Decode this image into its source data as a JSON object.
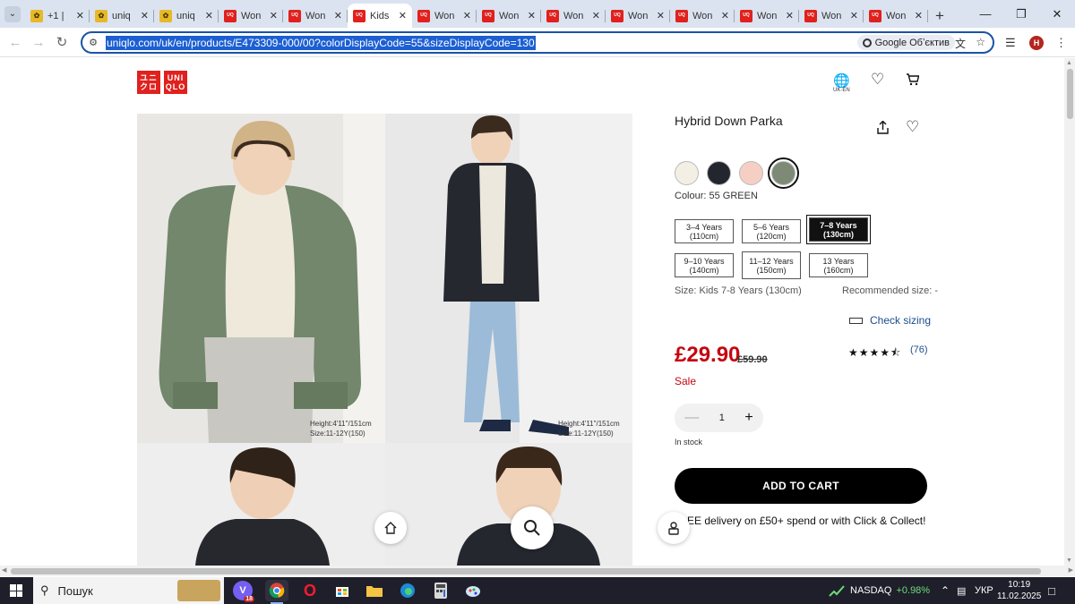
{
  "browser": {
    "tabs": [
      {
        "label": "+1 |",
        "icon": "yellow-icon",
        "active": false
      },
      {
        "label": "uniq",
        "icon": "yellow-icon",
        "active": false
      },
      {
        "label": "uniq",
        "icon": "yellow-icon",
        "active": false
      },
      {
        "label": "Won",
        "icon": "uniqlo-icon",
        "active": false
      },
      {
        "label": "Won",
        "icon": "uniqlo-icon",
        "active": false
      },
      {
        "label": "Kids",
        "icon": "uniqlo-icon",
        "active": true
      },
      {
        "label": "Won",
        "icon": "uniqlo-icon",
        "active": false
      },
      {
        "label": "Won",
        "icon": "uniqlo-icon",
        "active": false
      },
      {
        "label": "Won",
        "icon": "uniqlo-icon",
        "active": false
      },
      {
        "label": "Won",
        "icon": "uniqlo-icon",
        "active": false
      },
      {
        "label": "Won",
        "icon": "uniqlo-icon",
        "active": false
      },
      {
        "label": "Won",
        "icon": "uniqlo-icon",
        "active": false
      },
      {
        "label": "Won",
        "icon": "uniqlo-icon",
        "active": false
      },
      {
        "label": "Won",
        "icon": "uniqlo-icon",
        "active": false
      }
    ],
    "url": "uniqlo.com/uk/en/products/E473309-000/00?colorDisplayCode=55&sizeDisplayCode=130",
    "lens_label": "Google Обʼєктив",
    "profile_initial": "H"
  },
  "page": {
    "logo": {
      "line1": "ユニ",
      "line2": "クロ",
      "line3": "UNI",
      "line4": "QLO"
    },
    "region_label": "UK·EN",
    "photo_captions": {
      "first": {
        "line1": "Height:4'11\"/151cm",
        "line2": "Size:11-12Y(150)"
      },
      "second": {
        "line1": "Height:4'11\"/151cm",
        "line2": "Size:11-12Y(150)"
      }
    },
    "product": {
      "title": "Hybrid Down Parka",
      "colour_label": "Colour: 55 GREEN",
      "swatches": [
        {
          "color": "#f3efe4",
          "selected": false
        },
        {
          "color": "#23262e",
          "selected": false
        },
        {
          "color": "#f6cfc4",
          "selected": false
        },
        {
          "color": "#7d8a76",
          "selected": true
        }
      ],
      "sizes": [
        {
          "label1": "3–4 Years",
          "label2": "(110cm)",
          "selected": false
        },
        {
          "label1": "5–6 Years",
          "label2": "(120cm)",
          "selected": false
        },
        {
          "label1": "7–8 Years",
          "label2": "(130cm)",
          "selected": true
        },
        {
          "label1": "9–10 Years",
          "label2": "(140cm)",
          "selected": false
        },
        {
          "label1": "11–12 Years",
          "label2": "(150cm)",
          "selected": false
        },
        {
          "label1": "13 Years",
          "label2": "(160cm)",
          "selected": false
        }
      ],
      "size_label": "Size: Kids 7-8 Years (130cm)",
      "recommended_label": "Recommended size: -",
      "check_sizing": "Check sizing",
      "price": "£29.90",
      "old_price": "£59.90",
      "sale_label": "Sale",
      "rating_stars": 4.5,
      "review_count": "(76)",
      "quantity": "1",
      "stock_label": "In stock",
      "add_to_cart": "ADD TO CART",
      "delivery_note": "EE delivery on £50+ spend or with Click & Collect!"
    }
  },
  "taskbar": {
    "search_placeholder": "Пошук",
    "viber_badge": "18",
    "stock_name": "NASDAQ",
    "stock_change": "+0.98%",
    "language": "УКР",
    "time": "10:19",
    "date": "11.02.2025"
  }
}
